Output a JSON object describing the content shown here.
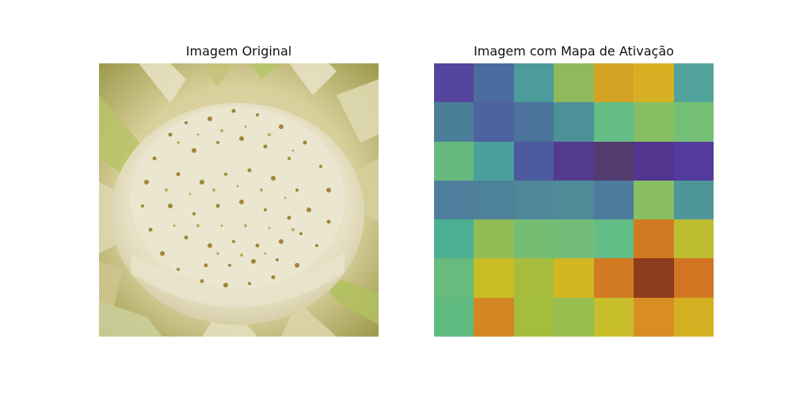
{
  "titles": {
    "left": "Imagem Original",
    "right": "Imagem com Mapa de Ativação"
  },
  "original_image": {
    "subject": "close-up of a white flower center covered with small golden pollen/seed particles, surrounded by pale green-yellow petals"
  },
  "heatmap": {
    "rows": 7,
    "cols": 7,
    "colors": [
      [
        "#54469e",
        "#4b6c9e",
        "#4c9c9c",
        "#8fba5b",
        "#d3a325",
        "#d6b022",
        "#52a39b"
      ],
      [
        "#4b7f99",
        "#4d629e",
        "#4b739c",
        "#4d9198",
        "#63bd84",
        "#86be64",
        "#73bf76"
      ],
      [
        "#66ba7f",
        "#4ba09b",
        "#4c5b9e",
        "#533a8c",
        "#523c6d",
        "#51358f",
        "#533b9b"
      ],
      [
        "#4f7f9d",
        "#4d8299",
        "#4f8699",
        "#4f8b98",
        "#4e7b9c",
        "#8abe63",
        "#4f9699"
      ],
      [
        "#4bb091",
        "#93bb56",
        "#75bd73",
        "#73bd78",
        "#62bd86",
        "#d17a21",
        "#bdbd32"
      ],
      [
        "#67bb7d",
        "#c9bd26",
        "#a6bd3c",
        "#d0b723",
        "#d17a21",
        "#8d3c1e",
        "#d17523"
      ],
      [
        "#60bb81",
        "#d18623",
        "#a5bd3d",
        "#97bd4d",
        "#c8bd2a",
        "#d98e23",
        "#d3b021"
      ]
    ]
  }
}
